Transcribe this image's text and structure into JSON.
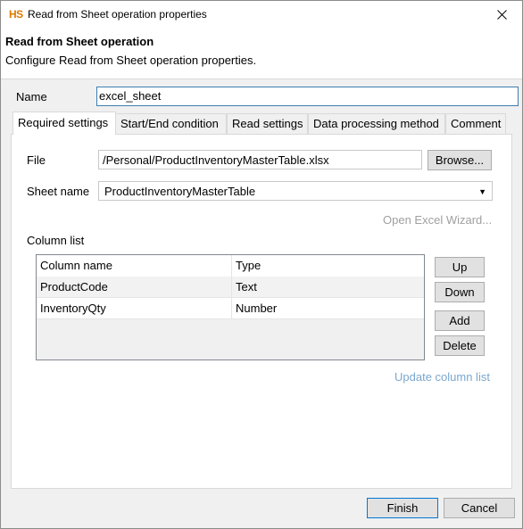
{
  "window": {
    "app_icon": "HS",
    "title": "Read from Sheet operation properties",
    "close_glyph": "✕"
  },
  "header": {
    "title": "Read from Sheet operation",
    "description": "Configure Read from Sheet operation properties."
  },
  "name": {
    "label": "Name",
    "value": "excel_sheet"
  },
  "tabs": [
    {
      "label": "Required settings",
      "active": true
    },
    {
      "label": "Start/End condition",
      "active": false
    },
    {
      "label": "Read settings",
      "active": false
    },
    {
      "label": "Data processing method",
      "active": false
    },
    {
      "label": "Comment",
      "active": false
    }
  ],
  "required": {
    "file_label": "File",
    "file_value": "/Personal/ProductInventoryMasterTable.xlsx",
    "browse_label": "Browse...",
    "sheet_label": "Sheet name",
    "sheet_value": "ProductInventoryMasterTable",
    "wizard_label": "Open Excel Wizard...",
    "column_list_label": "Column list",
    "table": {
      "headers": [
        "Column name",
        "Type"
      ],
      "rows": [
        [
          "ProductCode",
          "Text"
        ],
        [
          "InventoryQty",
          "Number"
        ]
      ]
    },
    "up_label": "Up",
    "down_label": "Down",
    "add_label": "Add",
    "delete_label": "Delete",
    "update_label": "Update column list"
  },
  "footer": {
    "finish_label": "Finish",
    "cancel_label": "Cancel"
  },
  "colors": {
    "accent": "#0078d7",
    "icon_orange": "#e07a00",
    "link": "#7aa7cf",
    "disabled": "#a0a0a0"
  }
}
